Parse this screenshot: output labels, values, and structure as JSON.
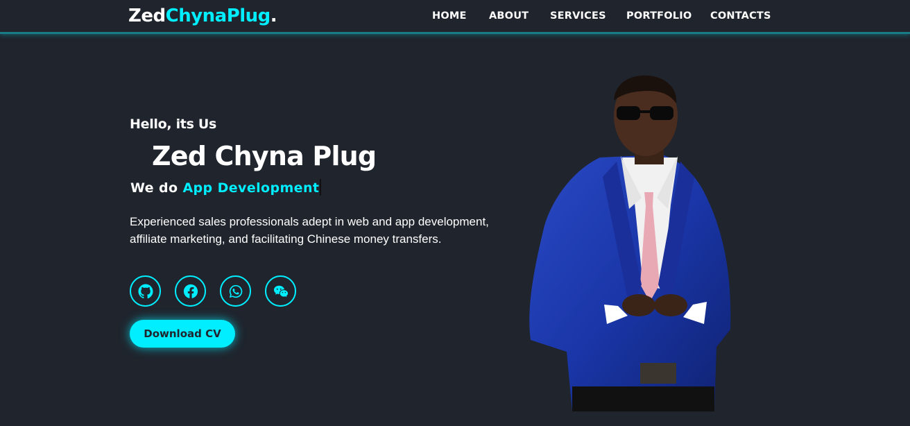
{
  "header": {
    "logo_main": "Zed",
    "logo_accent": "ChynaPlug",
    "logo_dot": ".",
    "nav": [
      "HOME",
      "ABOUT",
      "SERVICES",
      "PORTFOLIO",
      "CONTACTS"
    ]
  },
  "home": {
    "greeting": "Hello, its Us",
    "name": "Zed Chyna Plug",
    "tagline_prefix": "We do",
    "tagline_accent": "App Development",
    "description": "Experienced sales professionals adept in web and app development, affiliate marketing, and facilitating Chinese money transfers.",
    "social_icons": [
      "github-icon",
      "facebook-icon",
      "whatsapp-icon",
      "wechat-icon"
    ],
    "cv_button": "Download CV"
  },
  "colors": {
    "background": "#1f242d",
    "accent": "#00eeff",
    "text": "#ffffff"
  }
}
